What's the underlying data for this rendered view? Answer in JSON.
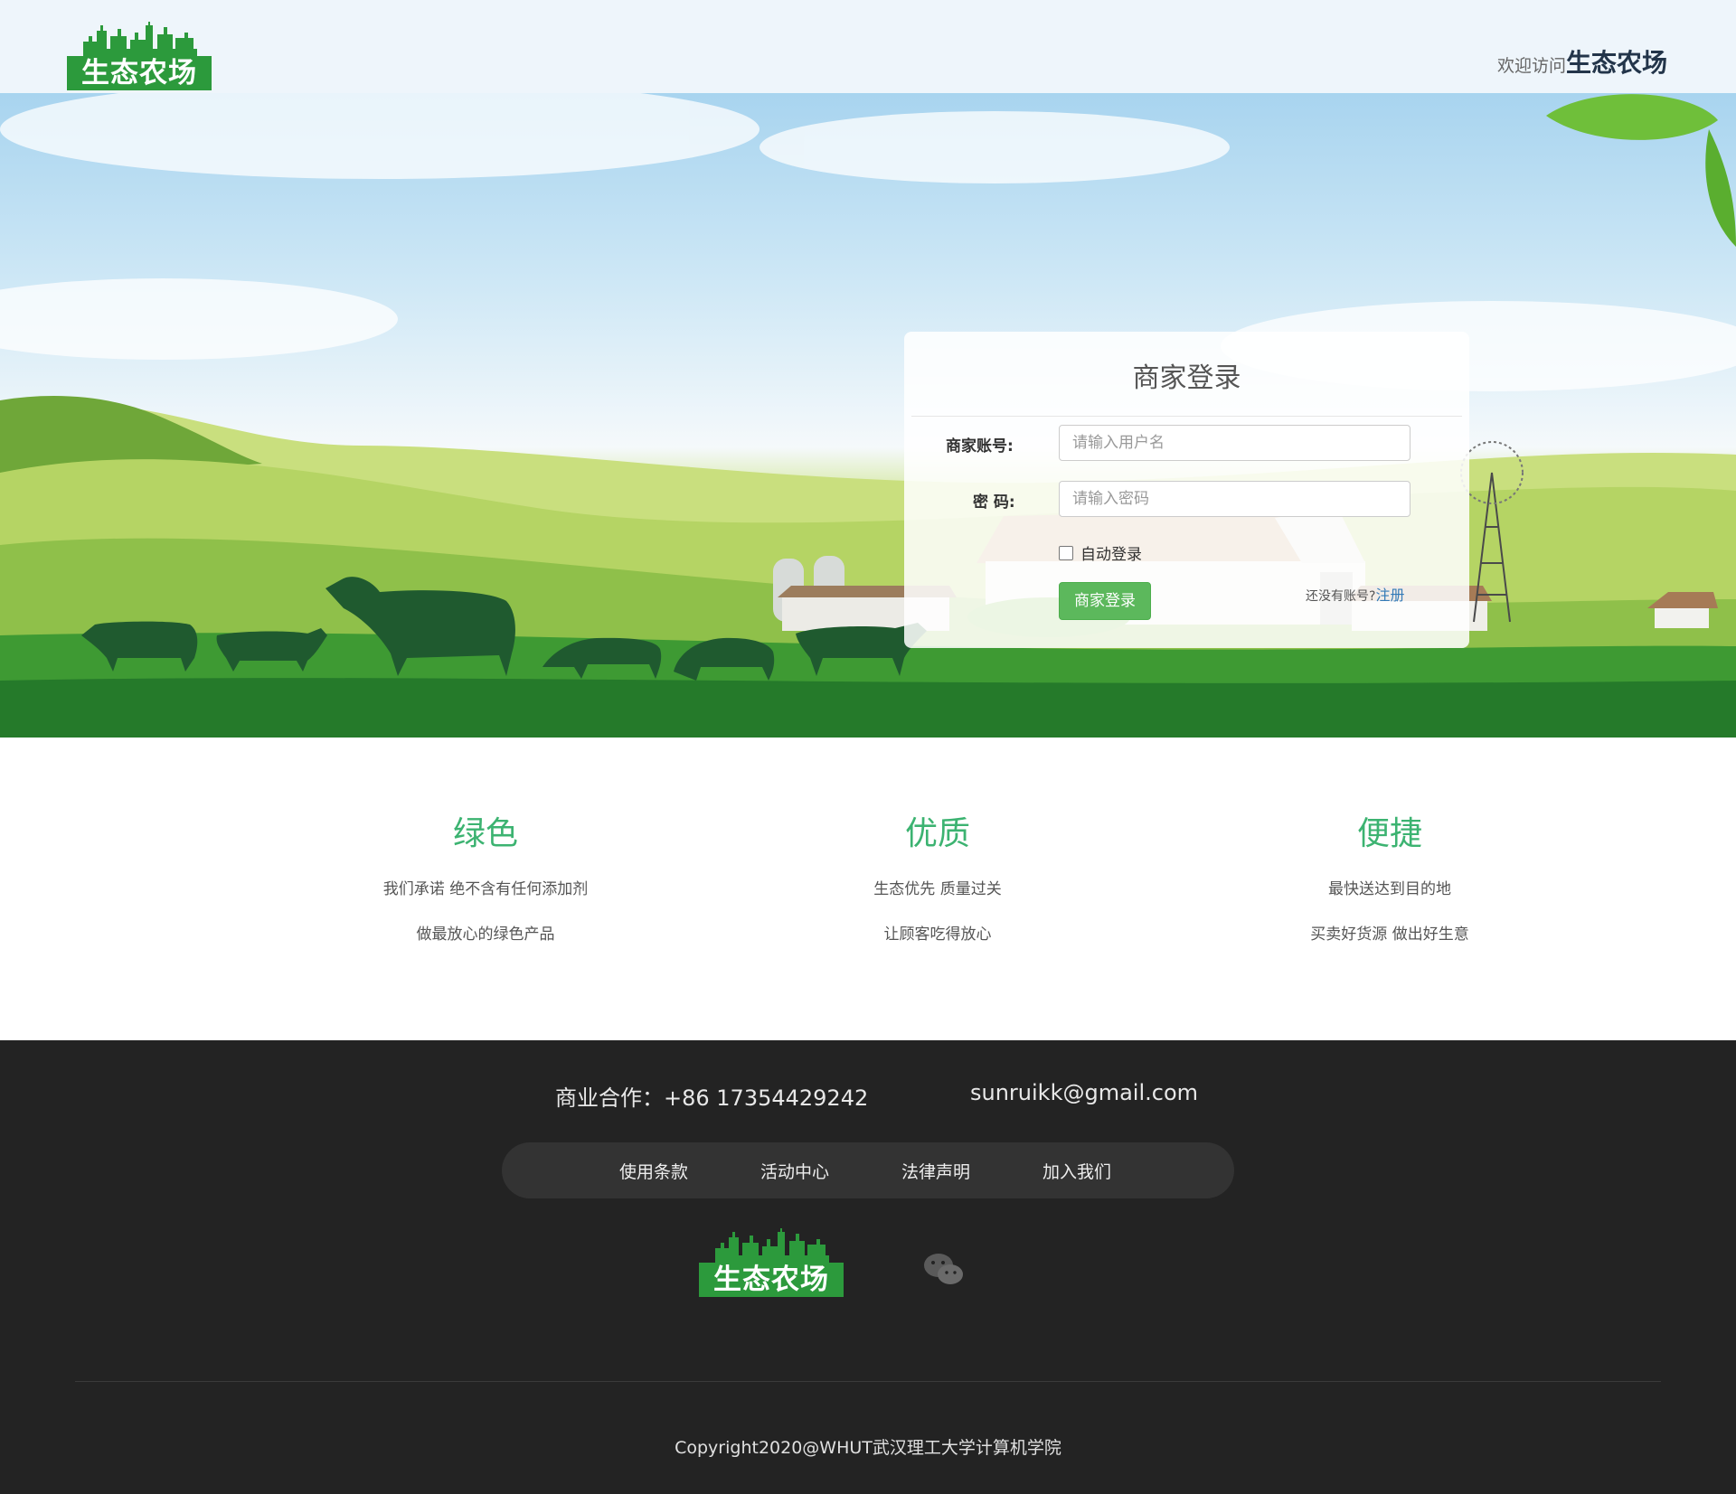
{
  "header": {
    "logo_text": "生态农场",
    "welcome_prefix": "欢迎访问",
    "welcome_brand": "生态农场"
  },
  "login": {
    "title": "商家登录",
    "account_label": "商家账号:",
    "account_placeholder": "请输入用户名",
    "password_label": "密 码:",
    "password_placeholder": "请输入密码",
    "remember_label": "自动登录",
    "remember_checked": false,
    "submit_label": "商家登录",
    "register_prompt": "还没有账号?",
    "register_link": "注册"
  },
  "features": [
    {
      "title": "绿色",
      "line1": "我们承诺 绝不含有任何添加剂",
      "line2": "做最放心的绿色产品"
    },
    {
      "title": "优质",
      "line1": "生态优先 质量过关",
      "line2": "让顾客吃得放心"
    },
    {
      "title": "便捷",
      "line1": "最快送达到目的地",
      "line2": "买卖好货源 做出好生意"
    }
  ],
  "footer": {
    "business_contact": "商业合作：+86 17354429242",
    "email": "sunruikk@gmail.com",
    "links": [
      "使用条款",
      "活动中心",
      "法律声明",
      "加入我们"
    ],
    "logo_text": "生态农场",
    "social_icon": "wechat-icon",
    "copyright": "Copyright2020@WHUT武汉理工大学计算机学院"
  },
  "colors": {
    "brand_green": "#2c9a3c",
    "feature_title": "#3cb371",
    "button_green": "#5cb85c",
    "link_blue": "#337ab7",
    "footer_bg": "#232323"
  }
}
